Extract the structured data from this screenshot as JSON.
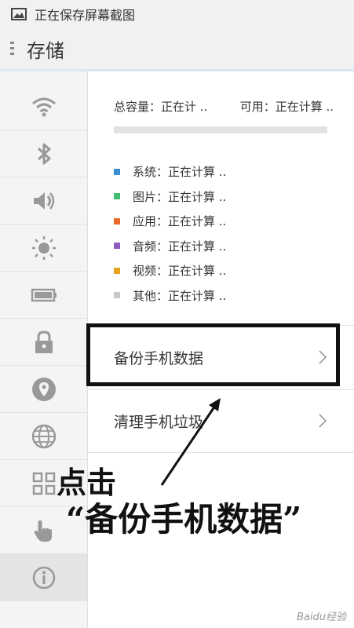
{
  "status_bar": {
    "text": "正在保存屏幕截图",
    "icon": "image-icon"
  },
  "action_bar": {
    "title": "存储",
    "menu_icon": "menu-dots-icon"
  },
  "sidebar": {
    "items": [
      {
        "icon": "wifi-icon"
      },
      {
        "icon": "bluetooth-icon"
      },
      {
        "icon": "sound-icon"
      },
      {
        "icon": "brightness-icon"
      },
      {
        "icon": "battery-icon"
      },
      {
        "icon": "lock-icon"
      },
      {
        "icon": "location-icon"
      },
      {
        "icon": "globe-icon"
      },
      {
        "icon": "apps-grid-icon"
      },
      {
        "icon": "gesture-hand-icon"
      },
      {
        "icon": "info-icon",
        "active": true
      }
    ]
  },
  "storage": {
    "total_label": "总容量：正在计 ..",
    "available_label": "可用：正在计算 ..",
    "usage_bar_fill": 0,
    "categories": [
      {
        "label": "系统：正在计算 ..",
        "color": "#3a8fd1"
      },
      {
        "label": "图片：正在计算 ..",
        "color": "#3fbf6f"
      },
      {
        "label": "应用：正在计算 ..",
        "color": "#e8692c"
      },
      {
        "label": "音频：正在计算 ..",
        "color": "#8e5bbf"
      },
      {
        "label": "视频：正在计算 ..",
        "color": "#e4a21f"
      },
      {
        "label": "其他：正在计算 ..",
        "color": "#c8c8c8"
      }
    ],
    "rows": [
      {
        "label": "备份手机数据"
      },
      {
        "label": "清理手机垃圾"
      }
    ]
  },
  "annotation": {
    "line1": "点击",
    "line2": "“备份手机数据”"
  },
  "watermark": "Baidu经验"
}
